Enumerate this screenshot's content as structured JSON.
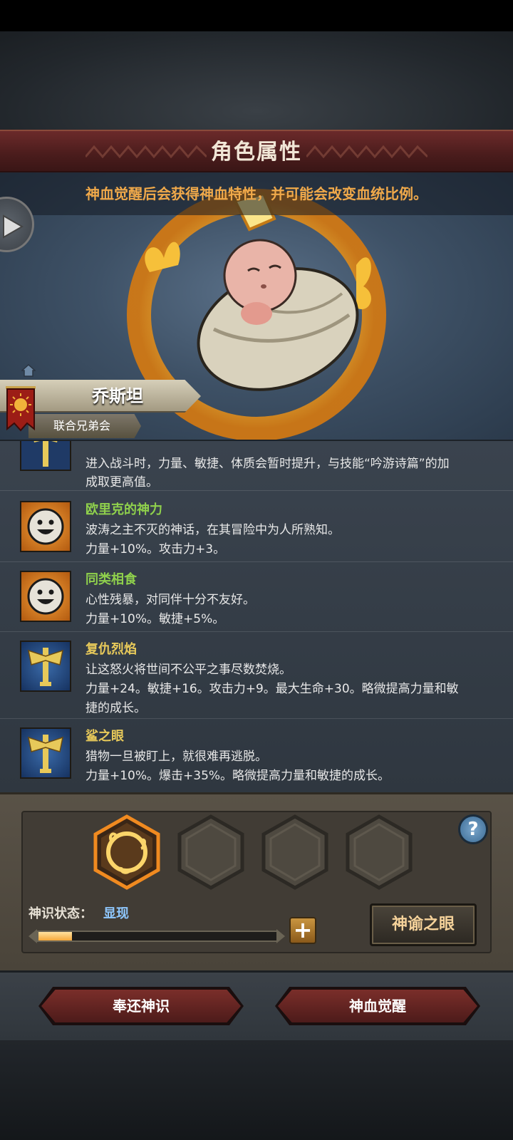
{
  "header": {
    "title": "角色属性"
  },
  "hero": {
    "info_text": "神血觉醒后会获得神血特性，并可能会改变血统比例。",
    "character_name": "乔斯坦",
    "guild_name": "联合兄弟会"
  },
  "traits": [
    {
      "name": "",
      "lines": [
        "进入战斗时，力量、敏捷、体质会暂时提升，与技能“吟游诗篇”的加",
        "成取更高值。"
      ],
      "color": "gold",
      "icon": "axe-icon"
    },
    {
      "name": "欧里克的神力",
      "lines": [
        "波涛之主不灭的神话，在其冒险中为人所熟知。",
        "力量+10%。攻击力+3。"
      ],
      "color": "green",
      "icon": "smiley-face-icon"
    },
    {
      "name": "同类相食",
      "lines": [
        "心性残暴，对同伴十分不友好。",
        "力量+10%。敏捷+5%。"
      ],
      "color": "green",
      "icon": "smiley-face-icon"
    },
    {
      "name": "复仇烈焰",
      "lines": [
        "让这怒火将世间不公平之事尽数焚烧。",
        "力量+24。敏捷+16。攻击力+9。最大生命+30。略微提高力量和敏",
        "捷的成长。"
      ],
      "color": "gold",
      "icon": "axe-icon"
    },
    {
      "name": "鲨之眼",
      "lines": [
        "猎物一旦被盯上，就很难再逃脱。",
        "力量+10%。爆击+35%。略微提高力量和敏捷的成长。"
      ],
      "color": "gold",
      "icon": "axe-icon"
    }
  ],
  "divine": {
    "status_label": "神识状态：",
    "status_value": "显现",
    "progress": 0.14,
    "oracle_button": "神谕之眼",
    "help_label": "?"
  },
  "actions": {
    "return_button": "奉还神识",
    "awaken_button": "神血觉醒"
  },
  "colors": {
    "accent_orange": "#f0a94a",
    "trait_green": "#8fd04c",
    "trait_gold": "#e7c95a",
    "status_blue": "#8fc8ff"
  }
}
